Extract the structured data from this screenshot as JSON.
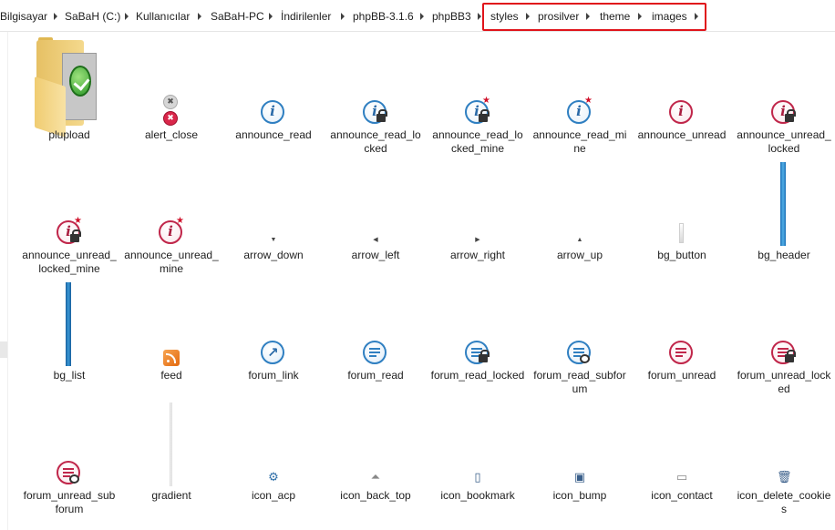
{
  "breadcrumb": {
    "items": [
      "Bilgisayar",
      "SaBaH (C:)",
      "Kullanıcılar",
      "SaBaH-PC",
      "İndirilenler",
      "phpBB-3.1.6",
      "phpBB3",
      "styles",
      "prosilver",
      "theme",
      "images"
    ]
  },
  "highlight_color": "#e0141b",
  "files": [
    {
      "name": "plupload",
      "icon": "folder-icon"
    },
    {
      "name": "alert_close",
      "icon": "alert-close-icon"
    },
    {
      "name": "announce_read",
      "icon": "info-icon"
    },
    {
      "name": "announce_read_locked",
      "icon": "info-lock-icon"
    },
    {
      "name": "announce_read_locked_mine",
      "icon": "info-lock-star-icon"
    },
    {
      "name": "announce_read_mine",
      "icon": "info-star-icon"
    },
    {
      "name": "announce_unread",
      "icon": "info-red-icon"
    },
    {
      "name": "announce_unread_locked",
      "icon": "info-red-lock-icon"
    },
    {
      "name": "announce_unread_locked_mine",
      "icon": "info-red-lock-star-icon"
    },
    {
      "name": "announce_unread_mine",
      "icon": "info-red-star-icon"
    },
    {
      "name": "arrow_down",
      "icon": "arrow-down-icon"
    },
    {
      "name": "arrow_left",
      "icon": "arrow-left-icon"
    },
    {
      "name": "arrow_right",
      "icon": "arrow-right-icon"
    },
    {
      "name": "arrow_up",
      "icon": "arrow-up-icon"
    },
    {
      "name": "bg_button",
      "icon": "bg-button-icon"
    },
    {
      "name": "bg_header",
      "icon": "bg-header-icon"
    },
    {
      "name": "bg_list",
      "icon": "bg-list-icon"
    },
    {
      "name": "feed",
      "icon": "rss-feed-icon"
    },
    {
      "name": "forum_link",
      "icon": "forum-link-icon"
    },
    {
      "name": "forum_read",
      "icon": "forum-read-icon"
    },
    {
      "name": "forum_read_locked",
      "icon": "forum-read-locked-icon"
    },
    {
      "name": "forum_read_subforum",
      "icon": "forum-read-subforum-icon"
    },
    {
      "name": "forum_unread",
      "icon": "forum-unread-icon"
    },
    {
      "name": "forum_unread_locked",
      "icon": "forum-unread-locked-icon"
    },
    {
      "name": "forum_unread_subforum",
      "icon": "forum-unread-subforum-icon"
    },
    {
      "name": "gradient",
      "icon": "gradient-icon"
    },
    {
      "name": "icon_acp",
      "icon": "acp-gears-icon"
    },
    {
      "name": "icon_back_top",
      "icon": "back-top-icon"
    },
    {
      "name": "icon_bookmark",
      "icon": "bookmark-icon"
    },
    {
      "name": "icon_bump",
      "icon": "bump-icon"
    },
    {
      "name": "icon_contact",
      "icon": "contact-bubble-icon"
    },
    {
      "name": "icon_delete_cookies",
      "icon": "trash-icon"
    }
  ]
}
